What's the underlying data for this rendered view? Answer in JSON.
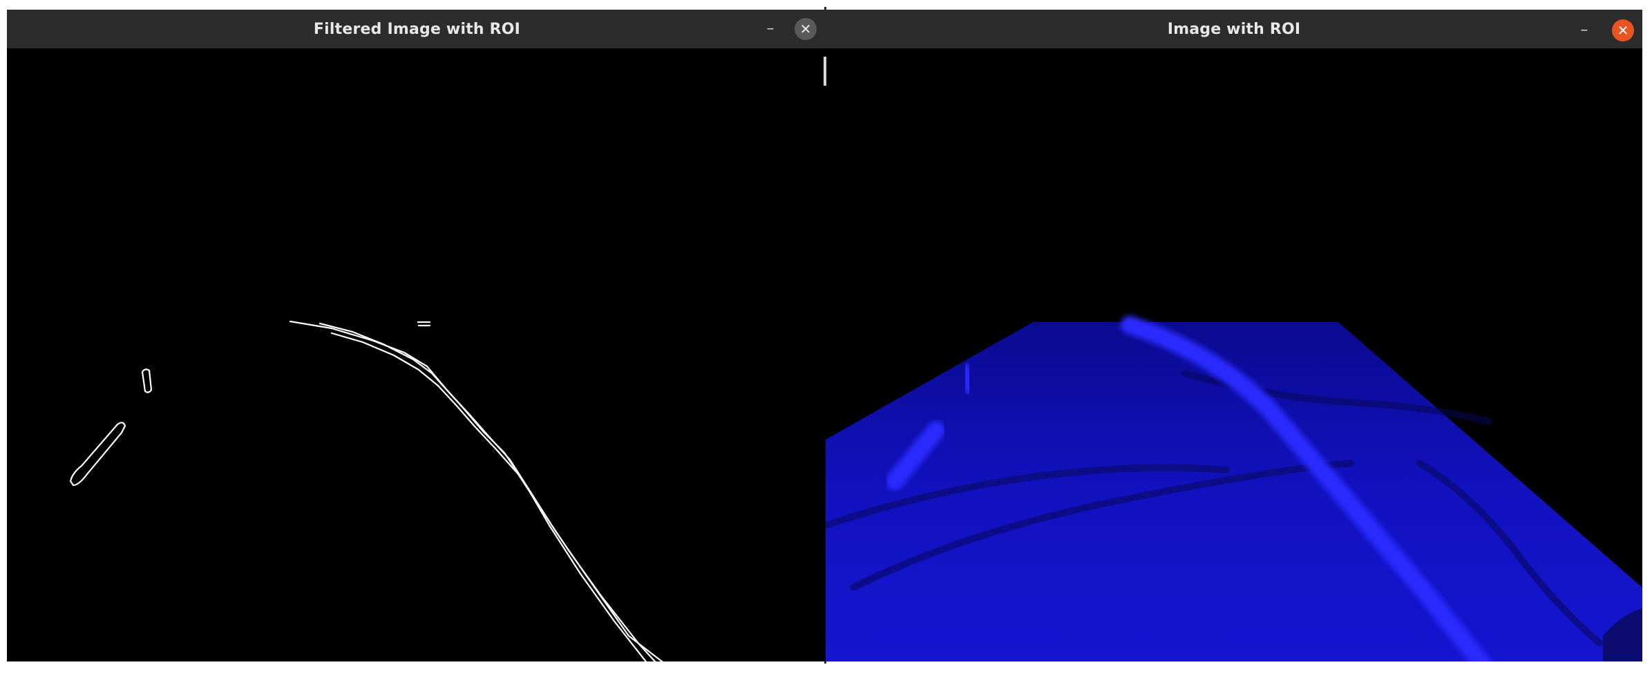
{
  "windows": {
    "left": {
      "title": "Filtered Image with ROI",
      "minimize_glyph": "–",
      "close_glyph": "✕"
    },
    "right": {
      "title": "Image with ROI",
      "minimize_glyph": "–",
      "close_glyph": "✕"
    }
  },
  "icons": {
    "minimize": "minimize-icon",
    "close": "close-icon"
  },
  "colors": {
    "titlebar_bg": "#2c2c2c",
    "title_text": "#e8e8e8",
    "left_close_bg": "#5a5a5a",
    "right_close_bg": "#e95420",
    "canvas_bg": "#000000",
    "edge_lines": "#ffffff",
    "roi_fill": "#1010c8",
    "lane_highlight": "#2a2aff"
  }
}
